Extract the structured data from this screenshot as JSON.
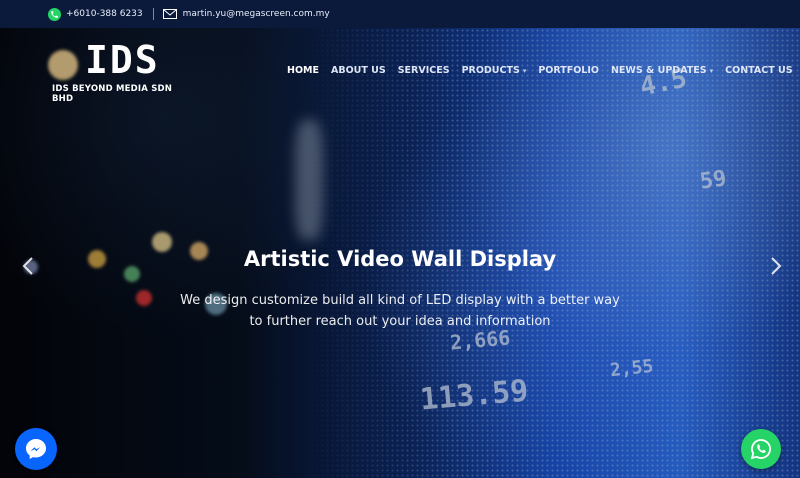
{
  "topbar": {
    "phone": "+6010-388 6233",
    "email": "martin.yu@megascreen.com.my"
  },
  "logo": {
    "mark": "IDS",
    "company": "IDS BEYOND MEDIA SDN BHD"
  },
  "nav": [
    {
      "label": "HOME",
      "has_dropdown": false,
      "active": true
    },
    {
      "label": "ABOUT US",
      "has_dropdown": false
    },
    {
      "label": "SERVICES",
      "has_dropdown": false
    },
    {
      "label": "PRODUCTS",
      "has_dropdown": true
    },
    {
      "label": "PORTFOLIO",
      "has_dropdown": false
    },
    {
      "label": "NEWS & UPDATES",
      "has_dropdown": true
    },
    {
      "label": "CONTACT US",
      "has_dropdown": false
    }
  ],
  "hero": {
    "title": "Artistic Video Wall Display",
    "subtitle_line1": "We design customize build all kind of LED display with a better way",
    "subtitle_line2": "to further reach out your idea and information",
    "prev_icon": "chevron-left-icon",
    "next_icon": "chevron-right-icon"
  },
  "floating": {
    "messenger_icon": "messenger-icon",
    "whatsapp_icon": "whatsapp-icon"
  },
  "colors": {
    "topbar": "#0b1a3a",
    "whatsapp": "#25d366",
    "messenger": "#0866ff"
  }
}
